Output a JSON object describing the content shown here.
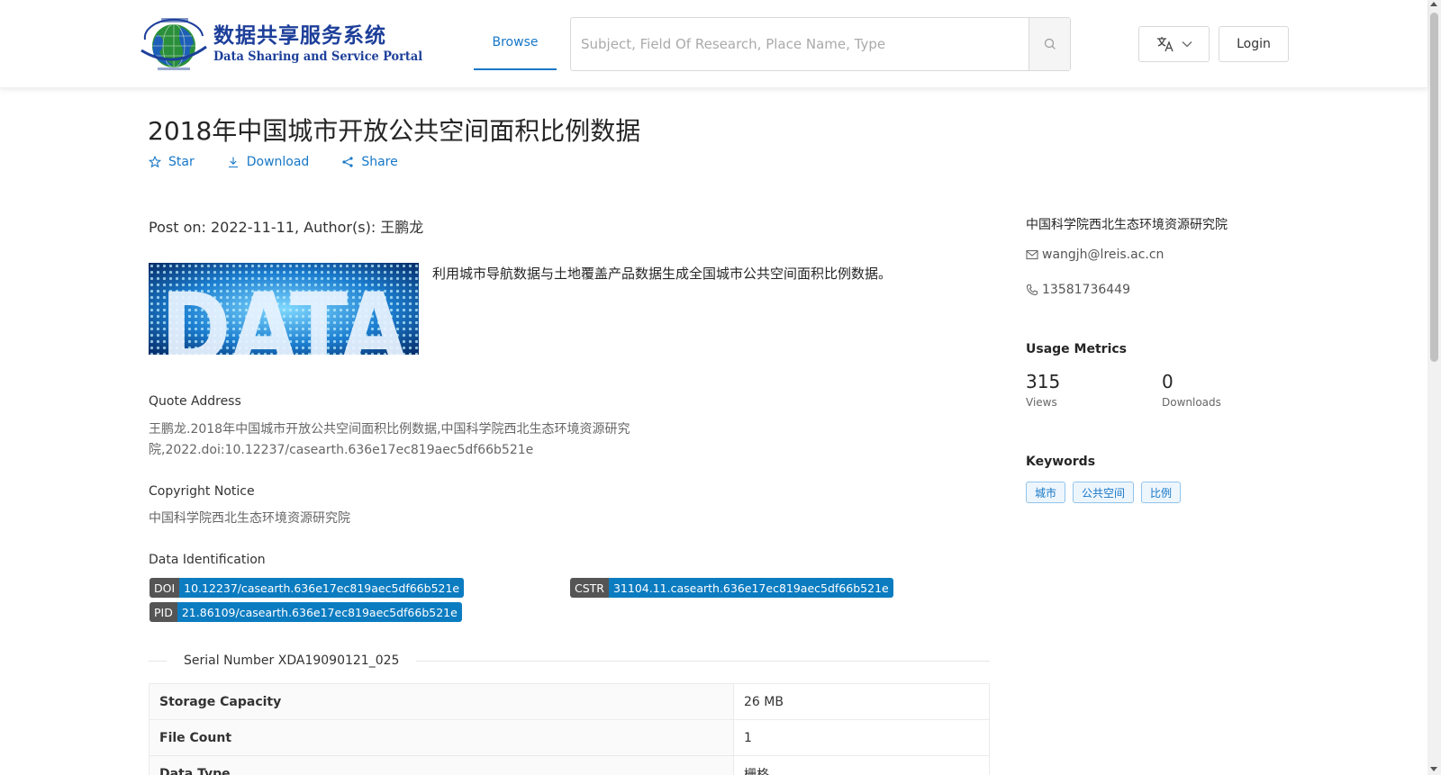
{
  "header": {
    "logo": {
      "cn_title": "数据共享服务系统",
      "en_title": "Data Sharing and Service Portal"
    },
    "nav": {
      "browse_label": "Browse"
    },
    "search": {
      "placeholder": "Subject, Field Of Research, Place Name, Type",
      "value": ""
    },
    "language_icon": "translate-icon",
    "login_label": "Login"
  },
  "dataset": {
    "title": "2018年中国城市开放公共空间面积比例数据",
    "actions": {
      "star": "Star",
      "download": "Download",
      "share": "Share"
    },
    "post_on": "Post on: 2022-11-11, Author(s): 王鹏龙",
    "thumbnail_text": "DATA",
    "description": "利用城市导航数据与土地覆盖产品数据生成全国城市公共空间面积比例数据。",
    "quote": {
      "label": "Quote Address",
      "line1": "王鹏龙.2018年中国城市开放公共空间面积比例数据,中国科学院西北生态环境资源研究",
      "line2": "院,2022.doi:10.12237/casearth.636e17ec819aec5df66b521e"
    },
    "copyright": {
      "label": "Copyright Notice",
      "text": "中国科学院西北生态环境资源研究院"
    },
    "identification": {
      "label": "Data Identification",
      "doi_key": "DOI",
      "doi_value": "10.12237/casearth.636e17ec819aec5df66b521e",
      "cstr_key": "CSTR",
      "cstr_value": "31104.11.casearth.636e17ec819aec5df66b521e",
      "pid_key": "PID",
      "pid_value": "21.86109/casearth.636e17ec819aec5df66b521e"
    },
    "serial_number": "Serial Number XDA19090121_025",
    "properties": [
      {
        "key": "Storage Capacity",
        "value": "26 MB"
      },
      {
        "key": "File Count",
        "value": "1"
      },
      {
        "key": "Data Type",
        "value": "栅格"
      }
    ]
  },
  "sidebar": {
    "organization": "中国科学院西北生态环境资源研究院",
    "email": "wangjh@lreis.ac.cn",
    "phone": "13581736449",
    "usage_metrics": {
      "title": "Usage Metrics",
      "views": "315",
      "views_label": "Views",
      "downloads": "0",
      "downloads_label": "Downloads"
    },
    "keywords": {
      "title": "Keywords",
      "items": [
        "城市",
        "公共空间",
        "比例"
      ]
    }
  },
  "colors": {
    "accent": "#1677c7",
    "badge_key_bg": "#555555",
    "badge_value_bg": "#0c7cc1",
    "logo_blue": "#1d3f9a"
  }
}
